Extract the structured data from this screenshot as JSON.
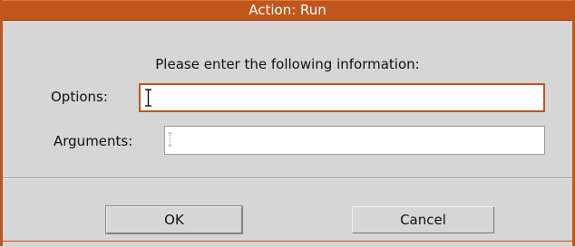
{
  "window": {
    "title": "Action: Run",
    "prompt": "Please enter the following information:"
  },
  "form": {
    "options": {
      "label": "Options:",
      "value": ""
    },
    "arguments": {
      "label": "Arguments:",
      "value": ""
    }
  },
  "buttons": {
    "ok_label": "OK",
    "cancel_label": "Cancel"
  },
  "colors": {
    "accent": "#c0561b",
    "background": "#d6d6d6",
    "field_bg": "#ffffff"
  }
}
